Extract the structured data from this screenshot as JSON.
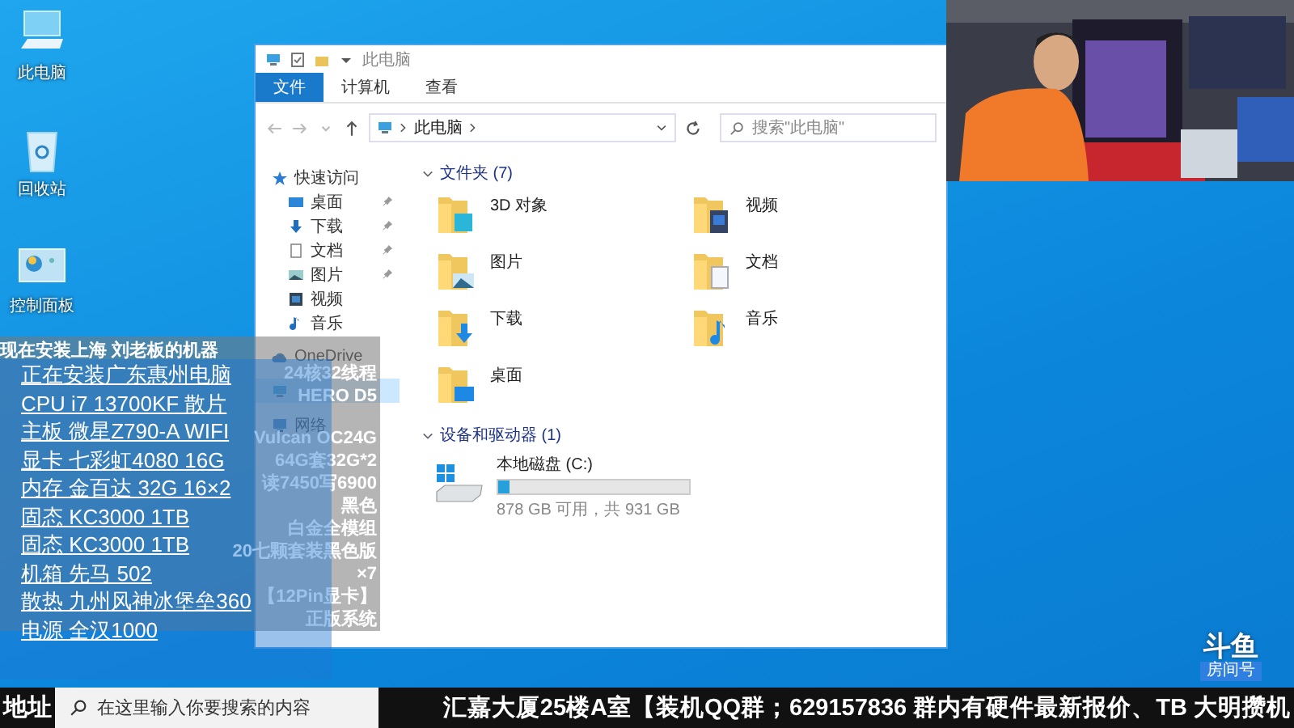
{
  "desktop": {
    "icons": [
      {
        "label": "此电脑",
        "kind": "pc"
      },
      {
        "label": "回收站",
        "kind": "bin"
      },
      {
        "label": "控制面板",
        "kind": "panel"
      }
    ]
  },
  "explorer": {
    "title": "此电脑",
    "tabs": [
      {
        "label": "文件",
        "selected": true
      },
      {
        "label": "计算机",
        "selected": false
      },
      {
        "label": "查看",
        "selected": false
      }
    ],
    "address": "此电脑",
    "search": {
      "placeholder": "搜索\"此电脑\""
    },
    "nav": [
      {
        "label": "快速访问",
        "kind": "star",
        "selected": false,
        "children": [
          {
            "label": "桌面",
            "kind": "desktop",
            "pinned": true,
            "selected": false
          },
          {
            "label": "下载",
            "kind": "downloads",
            "pinned": true,
            "selected": false
          },
          {
            "label": "文档",
            "kind": "documents",
            "pinned": true,
            "selected": false
          },
          {
            "label": "图片",
            "kind": "pictures",
            "pinned": true,
            "selected": false
          },
          {
            "label": "视频",
            "kind": "video",
            "pinned": false,
            "selected": false
          },
          {
            "label": "音乐",
            "kind": "music",
            "pinned": false,
            "selected": false
          }
        ]
      },
      {
        "label": "OneDrive",
        "kind": "cloud",
        "selected": false
      },
      {
        "kind": "pc",
        "selected": true
      },
      {
        "label": "网络",
        "kind": "network",
        "selected": false
      }
    ],
    "folders_header": "文件夹 (7)",
    "folders": [
      {
        "name": "3D 对象",
        "kind": "objects"
      },
      {
        "name": "视频",
        "kind": "video"
      },
      {
        "name": "图片",
        "kind": "pictures"
      },
      {
        "name": "文档",
        "kind": "documents"
      },
      {
        "name": "下载",
        "kind": "downloads"
      },
      {
        "name": "音乐",
        "kind": "music"
      },
      {
        "name": "桌面",
        "kind": "desktop"
      }
    ],
    "drives_header": "设备和驱动器 (1)",
    "drives": [
      {
        "name": "本地磁盘 (C:)",
        "level": 0.06,
        "free": "878 GB 可用，共 931 GB"
      }
    ]
  },
  "overlay": {
    "back_lines": [
      "现在安装上海  刘老板的机器",
      "24核32线程",
      "HERO D5"
    ],
    "back_lines_lower": [
      "Vulcan OC24G",
      "64G套32G*2",
      "读7450写6900",
      "黑色",
      "白金全模组",
      "20七颗套装黑色版",
      "×7",
      "【12Pin显卡】",
      "正版系统"
    ],
    "front_lines": [
      "正在安装广东惠州电脑",
      "CPU i7 13700KF 散片",
      "主板 微星Z790-A WIFI",
      "显卡 七彩虹4080 16G",
      "内存 金百达 32G 16×2",
      "固态 KC3000 1TB",
      "固态 KC3000 1TB",
      "机箱 先马 502",
      "散热 九州风神冰堡垒360",
      "电源 全汉1000"
    ]
  },
  "logo": {
    "name": "斗鱼",
    "sub": "房间号"
  },
  "ticker": {
    "prefix": "地址",
    "text": "汇嘉大厦25楼A室【装机QQ群；629157836  群内有硬件最新报价、TB 大明攒机"
  },
  "taskbar": {
    "search": {
      "placeholder": "在这里输入你要搜索的内容"
    }
  }
}
